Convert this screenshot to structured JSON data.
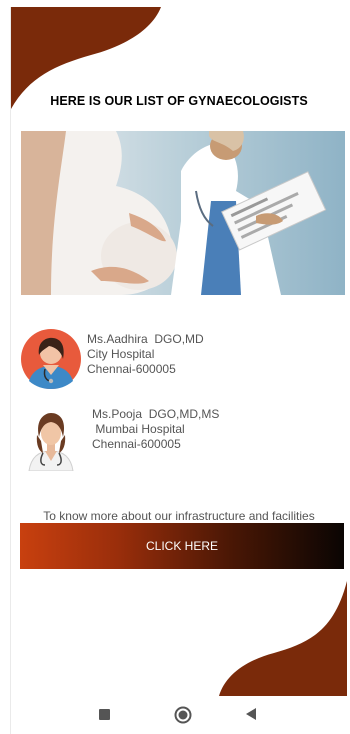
{
  "header": {
    "title": "HERE IS OUR LIST OF GYNAECOLOGISTS"
  },
  "doctors": [
    {
      "name": "Ms.Aadhira  DGO,MD",
      "hospital": "City Hospital",
      "address": "Chennai-600005"
    },
    {
      "name": "Ms.Pooja  DGO,MD,MS",
      "hospital": " Mumbai Hospital",
      "address": "Chennai-600005"
    }
  ],
  "footer_info": {
    "text": "To know more about our infrastructure and facilities",
    "button_label": "CLICK HERE"
  },
  "colors": {
    "accent_brown": "#7a2a0a",
    "button_start": "#c8400f",
    "button_end": "#0a0503"
  },
  "nav": {
    "icons": [
      "recent-apps-icon",
      "home-icon",
      "back-icon"
    ]
  }
}
